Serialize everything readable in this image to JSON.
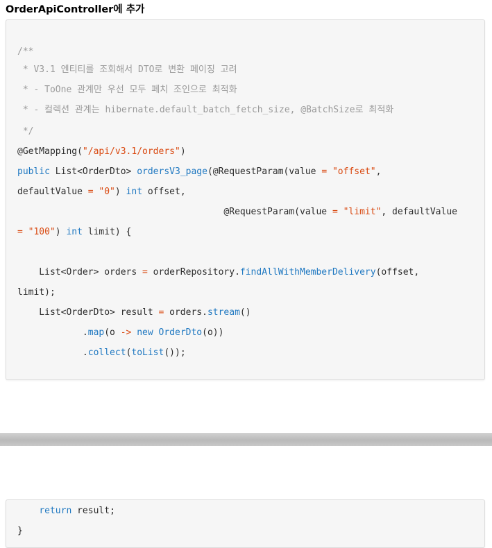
{
  "heading": "OrderApiController에 추가",
  "code_block_1": {
    "lines": [
      {
        "parts": [
          {
            "t": "cmt",
            "v": "/**"
          }
        ]
      },
      {
        "parts": [
          {
            "t": "cmt",
            "v": " * V3.1 엔티티를 조회해서 DTO로 변환 페이징 고려"
          }
        ]
      },
      {
        "parts": [
          {
            "t": "cmt",
            "v": " * - ToOne 관계만 우선 모두 페치 조인으로 최적화"
          }
        ]
      },
      {
        "parts": [
          {
            "t": "cmt",
            "v": " * - 컬렉션 관계는 hibernate.default_batch_fetch_size, @BatchSize로 최적화"
          }
        ]
      },
      {
        "parts": [
          {
            "t": "cmt",
            "v": " */"
          }
        ]
      },
      {
        "parts": [
          {
            "t": "plain",
            "v": "@GetMapping("
          },
          {
            "t": "str",
            "v": "\"/api/v3.1/orders\""
          },
          {
            "t": "plain",
            "v": ")"
          }
        ]
      },
      {
        "parts": [
          {
            "t": "kw",
            "v": "public"
          },
          {
            "t": "plain",
            "v": " List<OrderDto> "
          },
          {
            "t": "fn",
            "v": "ordersV3_page"
          },
          {
            "t": "plain",
            "v": "(@RequestParam(value "
          },
          {
            "t": "op",
            "v": "="
          },
          {
            "t": "plain",
            "v": " "
          },
          {
            "t": "str",
            "v": "\"offset\""
          },
          {
            "t": "plain",
            "v": ","
          }
        ]
      },
      {
        "parts": [
          {
            "t": "plain",
            "v": "defaultValue "
          },
          {
            "t": "op",
            "v": "="
          },
          {
            "t": "plain",
            "v": " "
          },
          {
            "t": "str",
            "v": "\"0\""
          },
          {
            "t": "plain",
            "v": ") "
          },
          {
            "t": "kw",
            "v": "int"
          },
          {
            "t": "plain",
            "v": " offset,"
          }
        ]
      },
      {
        "parts": [
          {
            "t": "plain",
            "v": "                                      @RequestParam(value "
          },
          {
            "t": "op",
            "v": "="
          },
          {
            "t": "plain",
            "v": " "
          },
          {
            "t": "str",
            "v": "\"limit\""
          },
          {
            "t": "plain",
            "v": ", defaultValue"
          }
        ]
      },
      {
        "parts": [
          {
            "t": "op",
            "v": "="
          },
          {
            "t": "plain",
            "v": " "
          },
          {
            "t": "str",
            "v": "\"100\""
          },
          {
            "t": "plain",
            "v": ") "
          },
          {
            "t": "kw",
            "v": "int"
          },
          {
            "t": "plain",
            "v": " limit) {"
          }
        ]
      },
      {
        "parts": [
          {
            "t": "plain",
            "v": ""
          }
        ]
      },
      {
        "parts": [
          {
            "t": "plain",
            "v": "    List<Order> orders "
          },
          {
            "t": "op",
            "v": "="
          },
          {
            "t": "plain",
            "v": " orderRepository."
          },
          {
            "t": "fn",
            "v": "findAllWithMemberDelivery"
          },
          {
            "t": "plain",
            "v": "(offset,"
          }
        ]
      },
      {
        "parts": [
          {
            "t": "plain",
            "v": "limit);"
          }
        ]
      },
      {
        "parts": [
          {
            "t": "plain",
            "v": "    List<OrderDto> result "
          },
          {
            "t": "op",
            "v": "="
          },
          {
            "t": "plain",
            "v": " orders."
          },
          {
            "t": "fn",
            "v": "stream"
          },
          {
            "t": "plain",
            "v": "()"
          }
        ]
      },
      {
        "parts": [
          {
            "t": "plain",
            "v": "            ."
          },
          {
            "t": "fn",
            "v": "map"
          },
          {
            "t": "plain",
            "v": "(o "
          },
          {
            "t": "op",
            "v": "->"
          },
          {
            "t": "plain",
            "v": " "
          },
          {
            "t": "kw",
            "v": "new"
          },
          {
            "t": "plain",
            "v": " "
          },
          {
            "t": "fn",
            "v": "OrderDto"
          },
          {
            "t": "plain",
            "v": "(o))"
          }
        ]
      },
      {
        "parts": [
          {
            "t": "plain",
            "v": "            ."
          },
          {
            "t": "fn",
            "v": "collect"
          },
          {
            "t": "plain",
            "v": "("
          },
          {
            "t": "fn",
            "v": "toList"
          },
          {
            "t": "plain",
            "v": "());"
          }
        ]
      }
    ]
  },
  "code_block_2": {
    "lines": [
      {
        "parts": [
          {
            "t": "plain",
            "v": "    "
          },
          {
            "t": "kw",
            "v": "return"
          },
          {
            "t": "plain",
            "v": " result;"
          }
        ]
      },
      {
        "parts": [
          {
            "t": "plain",
            "v": "}"
          }
        ]
      }
    ]
  },
  "colors": {
    "comment": "#9a9a9a",
    "string": "#d9480f",
    "keyword": "#1f78c1",
    "plain": "#2b2b2b",
    "code_background": "#f6f6f6",
    "page_break": "#c4c4c4"
  }
}
